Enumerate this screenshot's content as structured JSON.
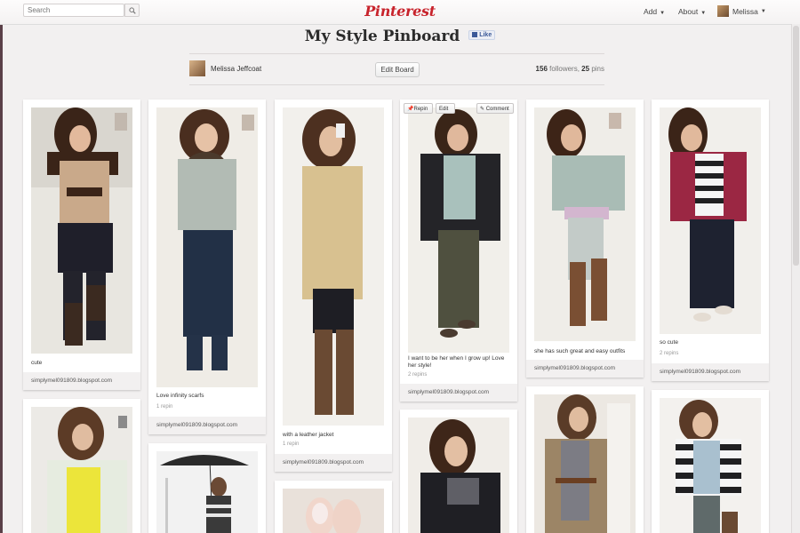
{
  "search": {
    "placeholder": "Search"
  },
  "logo": "Pinterest",
  "nav": {
    "add": "Add",
    "about": "About",
    "user": "Melissa"
  },
  "board": {
    "title": "My Style Pinboard",
    "like": "Like",
    "owner": "Melissa Jeffcoat",
    "edit": "Edit Board",
    "followers_count": "156",
    "followers_label": "followers,",
    "pins_count": "25",
    "pins_label": "pins"
  },
  "pin_actions": {
    "repin": "Repin",
    "edit": "Edit",
    "comment": "Comment"
  },
  "pins": [
    {
      "description": "cute",
      "meta": "",
      "source": "simplymel091809.blogspot.com"
    },
    {
      "description": "Love infinity scarfs",
      "meta": "1 repin",
      "source": "simplymel091809.blogspot.com"
    },
    {
      "description": "with a leather jacket",
      "meta": "1 repin",
      "source": "simplymel091809.blogspot.com"
    },
    {
      "description": "I want to be her when I grow up! Love her style!",
      "meta": "2 repins",
      "source": "simplymel091809.blogspot.com"
    },
    {
      "description": "she has such great and easy outfits",
      "meta": "",
      "source": "simplymel091809.blogspot.com"
    },
    {
      "description": "so cute",
      "meta": "2 repins",
      "source": "simplymel091809.blogspot.com"
    }
  ],
  "icons": [
    "search-icon",
    "caret-down-icon",
    "facebook-icon"
  ]
}
